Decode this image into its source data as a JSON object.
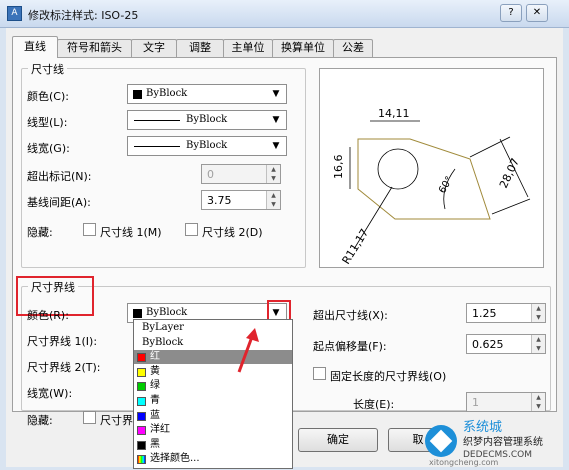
{
  "window": {
    "title": "修改标注样式: ISO-25",
    "icon_letter": "A"
  },
  "tabs": [
    "直线",
    "符号和箭头",
    "文字",
    "调整",
    "主单位",
    "换算单位",
    "公差"
  ],
  "dim_lines": {
    "title": "尺寸线",
    "color_label": "颜色(C):",
    "color_value": "ByBlock",
    "linetype_label": "线型(L):",
    "linetype_value": "ByBlock",
    "lineweight_label": "线宽(G):",
    "lineweight_value": "ByBlock",
    "extend_ticks_label": "超出标记(N):",
    "extend_ticks_value": "0",
    "baseline_spacing_label": "基线间距(A):",
    "baseline_spacing_value": "3.75",
    "suppress_label": "隐藏:",
    "suppress_line1": "尺寸线 1(M)",
    "suppress_line2": "尺寸线 2(D)"
  },
  "ext_lines": {
    "title": "尺寸界线",
    "color_label": "颜色(R):",
    "color_value": "ByBlock",
    "ext_line1_label": "尺寸界线 1(I):",
    "ext_line2_label": "尺寸界线 2(T):",
    "lineweight_label": "线宽(W):",
    "suppress_label": "隐藏:",
    "suppress_line1": "尺寸界",
    "extend_beyond_label": "超出尺寸线(X):",
    "extend_beyond_value": "1.25",
    "offset_origin_label": "起点偏移量(F):",
    "offset_origin_value": "0.625",
    "fixed_length_label": "固定长度的尺寸界线(O)",
    "length_label": "长度(E):",
    "length_value": "1"
  },
  "color_dropdown": [
    {
      "label": "ByLayer",
      "color": ""
    },
    {
      "label": "ByBlock",
      "color": ""
    },
    {
      "label": "红",
      "color": "#ff0000"
    },
    {
      "label": "黄",
      "color": "#ffff00"
    },
    {
      "label": "绿",
      "color": "#00cc00"
    },
    {
      "label": "青",
      "color": "#00ffff"
    },
    {
      "label": "蓝",
      "color": "#0000ff"
    },
    {
      "label": "洋红",
      "color": "#ff00ff"
    },
    {
      "label": "黑",
      "color": "#000000"
    },
    {
      "label": "选择颜色...",
      "color": ""
    }
  ],
  "preview": {
    "dim_top": "14,11",
    "dim_left": "16,6",
    "dim_slant": "28,07",
    "angle": "60°",
    "radius": "R11,17"
  },
  "buttons": {
    "ok": "确定",
    "cancel": "取"
  },
  "watermark": {
    "text1": "系统城",
    "text2": "织梦内容管理系统",
    "text3": "DEDECMS.COM",
    "text4": "xitongcheng.com"
  },
  "accent_red": "#e0242d"
}
